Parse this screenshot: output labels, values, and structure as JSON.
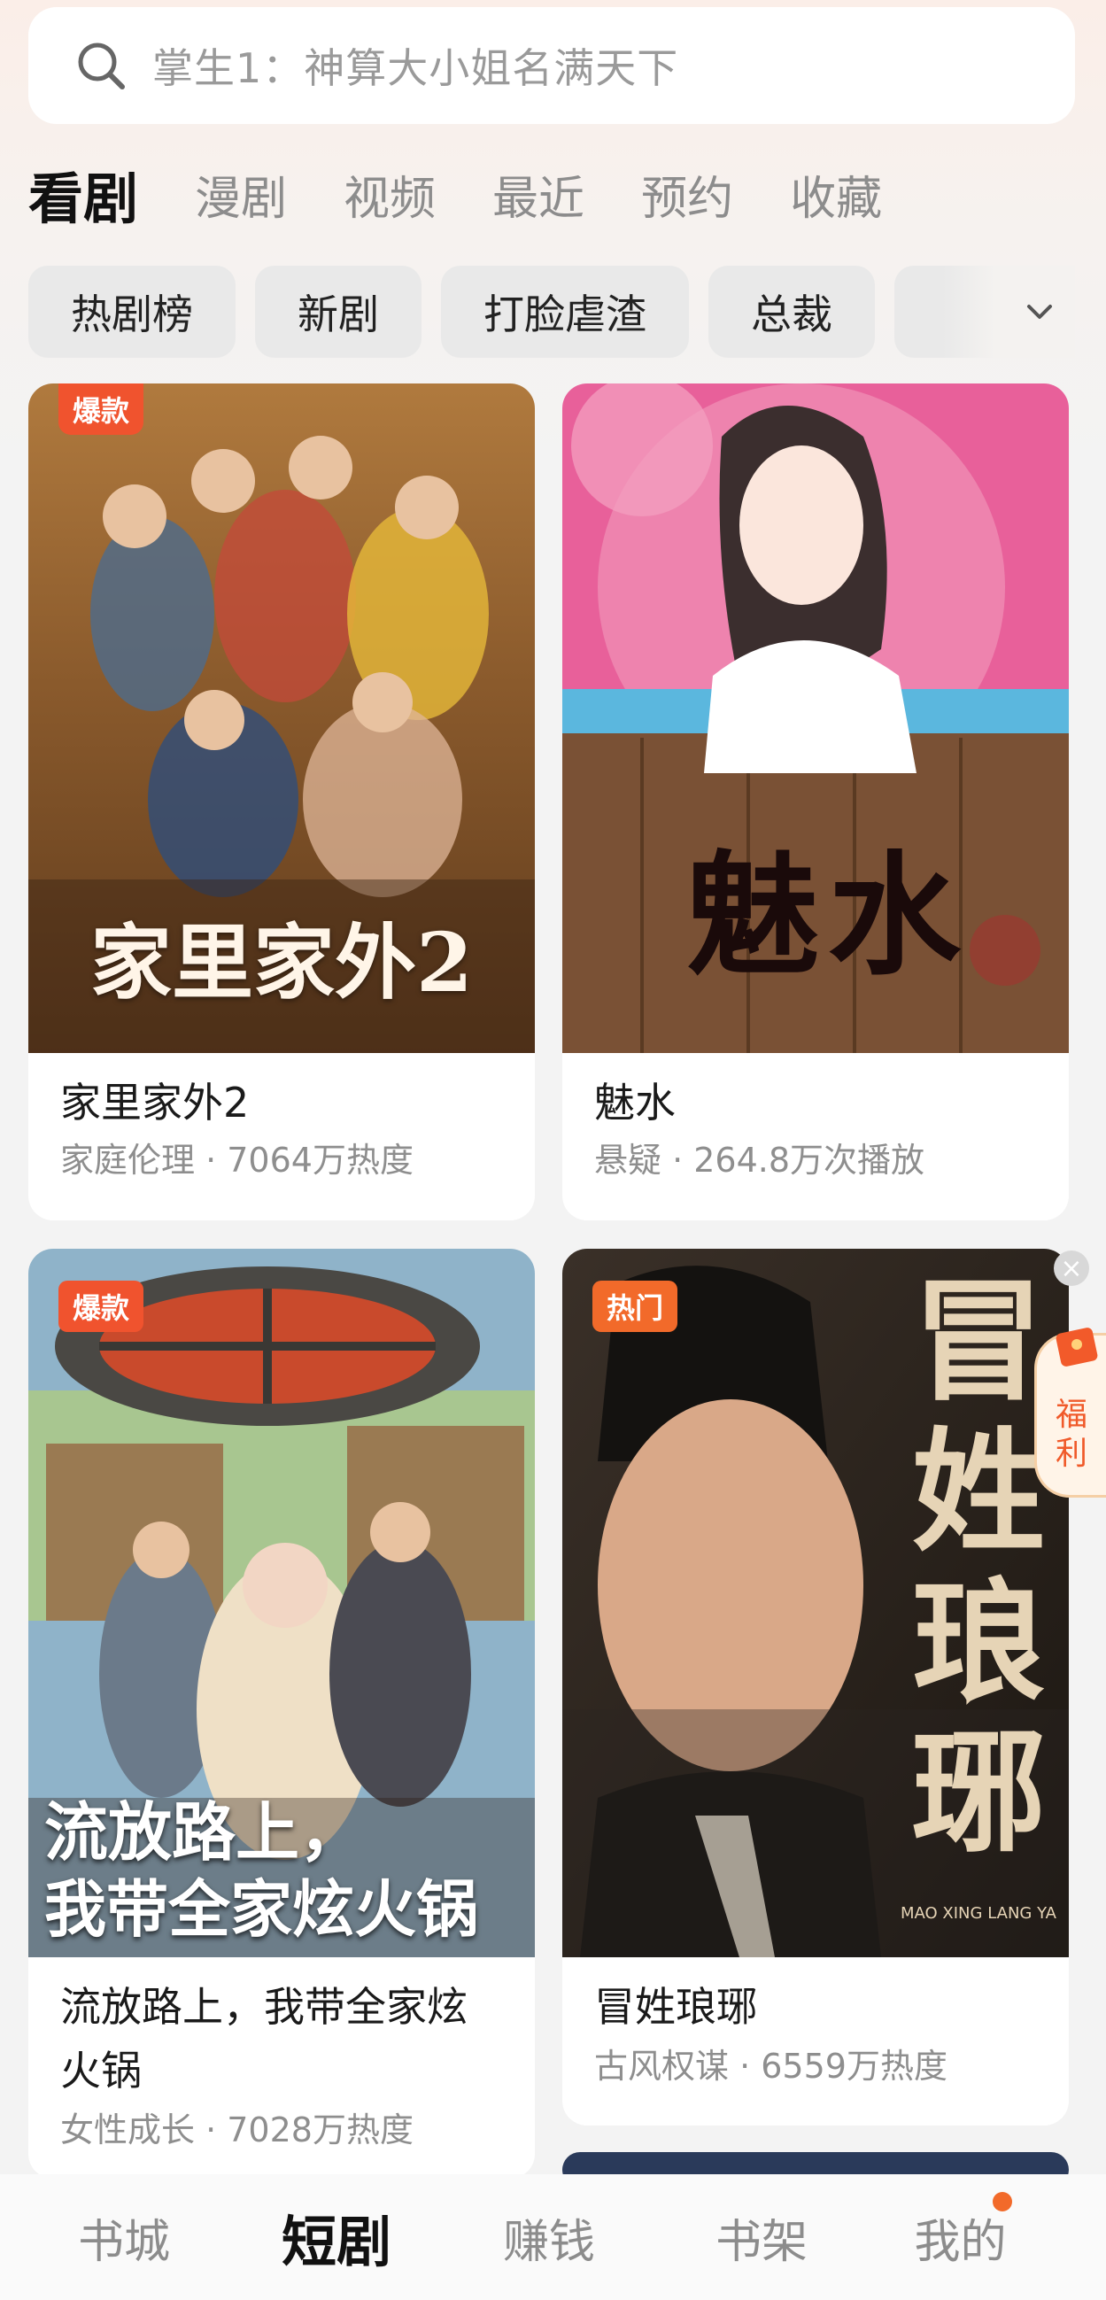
{
  "search": {
    "placeholder": "掌生1：神算大小姐名满天下"
  },
  "tabs": [
    {
      "label": "看剧",
      "active": true
    },
    {
      "label": "漫剧"
    },
    {
      "label": "视频"
    },
    {
      "label": "最近"
    },
    {
      "label": "预约"
    },
    {
      "label": "收藏"
    }
  ],
  "chips": [
    "热剧榜",
    "新剧",
    "打脸虐渣",
    "总裁"
  ],
  "cards": [
    {
      "badge": "爆款",
      "title": "家里家外2",
      "meta": "家庭伦理 · 7064万热度",
      "poster_text": "家里家外2"
    },
    {
      "badge": "",
      "title": "魅水",
      "meta": "悬疑 · 264.8万次播放",
      "poster_text": "魅水"
    },
    {
      "badge": "爆款",
      "title_line1": "流放路上，我带全家炫",
      "title_line2": "火锅",
      "meta": "女性成长 · 7028万热度",
      "poster_text_line1": "流放路上，",
      "poster_text_line2": "我带全家炫火锅"
    },
    {
      "badge": "热门",
      "title": "冒姓琅琊",
      "meta": "古风权谋 · 6559万热度",
      "poster_text": "冒姓琅琊",
      "poster_sub": "MAO XING LANG YA"
    }
  ],
  "welfare": {
    "line1": "福",
    "line2": "利"
  },
  "bottom_nav": [
    {
      "label": "书城"
    },
    {
      "label": "短剧",
      "active": true
    },
    {
      "label": "赚钱"
    },
    {
      "label": "书架"
    },
    {
      "label": "我的",
      "dot": true
    }
  ],
  "colors": {
    "accent": "#f26a2a",
    "badge": "#f0532e",
    "inactive": "#8c8c8c"
  }
}
